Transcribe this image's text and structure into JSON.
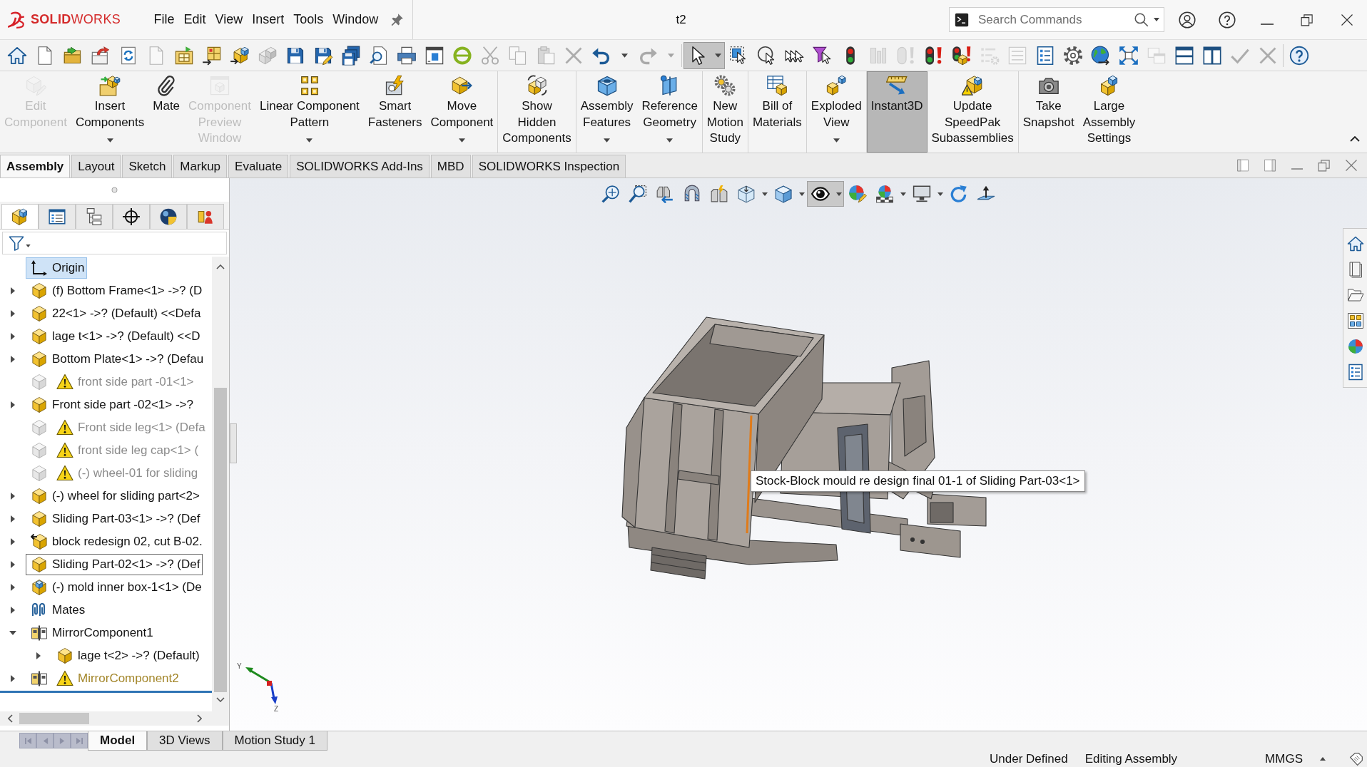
{
  "title_bar": {
    "logo": "**SOLID**WORKS",
    "menu": [
      "File",
      "Edit",
      "View",
      "Insert",
      "Tools",
      "Window"
    ],
    "document_title": "t2",
    "search": {
      "placeholder": "Search Commands"
    }
  },
  "standard_toolbar": {
    "groups": [
      [
        {
          "kind": "button",
          "disabled": false,
          "selected": false
        },
        {
          "kind": "button",
          "disabled": false,
          "selected": false
        },
        {
          "kind": "button",
          "disabled": false,
          "selected": false
        },
        {
          "kind": "button",
          "disabled": false,
          "selected": false
        },
        {
          "kind": "button",
          "disabled": false,
          "selected": false
        },
        {
          "kind": "button",
          "disabled": true,
          "selected": false
        },
        {
          "kind": "button",
          "disabled": false,
          "selected": false
        },
        {
          "kind": "button",
          "disabled": false,
          "selected": false
        },
        {
          "kind": "button",
          "disabled": false,
          "selected": false
        },
        {
          "kind": "button",
          "disabled": true,
          "selected": false
        },
        {
          "kind": "button",
          "disabled": false,
          "selected": false
        },
        {
          "kind": "button",
          "disabled": false,
          "selected": false
        },
        {
          "kind": "button",
          "disabled": false,
          "selected": false
        },
        {
          "kind": "button",
          "disabled": false,
          "selected": false
        },
        {
          "kind": "button",
          "disabled": false,
          "selected": false
        },
        {
          "kind": "button",
          "disabled": false,
          "selected": false
        },
        {
          "kind": "button",
          "disabled": false,
          "selected": false
        },
        {
          "kind": "button",
          "disabled": true,
          "selected": false
        },
        {
          "kind": "button",
          "disabled": true,
          "selected": false
        },
        {
          "kind": "button",
          "disabled": true,
          "selected": false
        },
        {
          "kind": "button",
          "disabled": true,
          "selected": false
        },
        {
          "kind": "split",
          "disabled": false,
          "selected": false
        },
        {
          "kind": "split",
          "disabled": true,
          "selected": false
        }
      ],
      [
        {
          "kind": "split",
          "disabled": false,
          "selected": true
        },
        {
          "kind": "button",
          "disabled": false,
          "selected": false
        },
        {
          "kind": "button",
          "disabled": false,
          "selected": false
        },
        {
          "kind": "button",
          "disabled": false,
          "selected": false
        },
        {
          "kind": "button",
          "disabled": false,
          "selected": false
        },
        {
          "kind": "button",
          "disabled": false,
          "selected": false
        },
        {
          "kind": "button",
          "disabled": true,
          "selected": false
        },
        {
          "kind": "button",
          "disabled": true,
          "selected": false
        },
        {
          "kind": "button",
          "disabled": false,
          "selected": false
        },
        {
          "kind": "button",
          "disabled": false,
          "selected": false
        },
        {
          "kind": "button",
          "disabled": true,
          "selected": false
        },
        {
          "kind": "button",
          "disabled": true,
          "selected": false
        },
        {
          "kind": "button",
          "disabled": false,
          "selected": false
        },
        {
          "kind": "button",
          "disabled": false,
          "selected": false
        },
        {
          "kind": "button",
          "disabled": false,
          "selected": false
        },
        {
          "kind": "button",
          "disabled": false,
          "selected": false
        },
        {
          "kind": "button",
          "disabled": true,
          "selected": false
        },
        {
          "kind": "button",
          "disabled": false,
          "selected": false
        },
        {
          "kind": "button",
          "disabled": false,
          "selected": false
        },
        {
          "kind": "button",
          "disabled": true,
          "selected": false
        },
        {
          "kind": "button",
          "disabled": true,
          "selected": false
        }
      ],
      [
        {
          "kind": "button",
          "disabled": false,
          "selected": false
        }
      ]
    ]
  },
  "command_manager": {
    "groups": [
      [
        {
          "label": "Edit\nComponent",
          "kind": "button",
          "disabled": true,
          "selected": false
        },
        {
          "label": "Insert\nComponents",
          "kind": "split",
          "disabled": false,
          "selected": false
        },
        {
          "label": "Mate",
          "kind": "button",
          "disabled": false,
          "selected": false
        },
        {
          "label": "Component\nPreview\nWindow",
          "kind": "button",
          "disabled": true,
          "selected": false
        },
        {
          "label": "Linear Component\nPattern",
          "kind": "split",
          "disabled": false,
          "selected": false
        },
        {
          "label": "Smart\nFasteners",
          "kind": "button",
          "disabled": false,
          "selected": false
        },
        {
          "label": "Move\nComponent",
          "kind": "split",
          "disabled": false,
          "selected": false
        }
      ],
      [
        {
          "label": "Show\nHidden\nComponents",
          "kind": "button",
          "disabled": false,
          "selected": false
        }
      ],
      [
        {
          "label": "Assembly\nFeatures",
          "kind": "split",
          "disabled": false,
          "selected": false
        },
        {
          "label": "Reference\nGeometry",
          "kind": "split",
          "disabled": false,
          "selected": false
        }
      ],
      [
        {
          "label": "New\nMotion\nStudy",
          "kind": "button",
          "disabled": false,
          "selected": false
        }
      ],
      [
        {
          "label": "Bill of\nMaterials",
          "kind": "button",
          "disabled": false,
          "selected": false
        }
      ],
      [
        {
          "label": "Exploded\nView",
          "kind": "split",
          "disabled": false,
          "selected": false
        }
      ],
      [
        {
          "label": "Instant3D",
          "kind": "button",
          "disabled": false,
          "selected": true
        },
        {
          "label": "Update\nSpeedPak\nSubassemblies",
          "kind": "button",
          "disabled": false,
          "selected": false
        }
      ],
      [
        {
          "label": "Take\nSnapshot",
          "kind": "button",
          "disabled": false,
          "selected": false
        },
        {
          "label": "Large\nAssembly\nSettings",
          "kind": "button",
          "disabled": false,
          "selected": false
        }
      ]
    ]
  },
  "command_tabs": [
    {
      "label": "Assembly",
      "selected": true
    },
    {
      "label": "Layout",
      "selected": false
    },
    {
      "label": "Sketch",
      "selected": false
    },
    {
      "label": "Markup",
      "selected": false
    },
    {
      "label": "Evaluate",
      "selected": false
    },
    {
      "label": "SOLIDWORKS Add-Ins",
      "selected": false
    },
    {
      "label": "MBD",
      "selected": false
    },
    {
      "label": "SOLIDWORKS Inspection",
      "selected": false
    }
  ],
  "feature_tree": {
    "panel_tabs": [
      {
        "selected": true
      },
      {
        "selected": false
      },
      {
        "selected": false
      },
      {
        "selected": false
      },
      {
        "selected": false
      },
      {
        "selected": false
      }
    ],
    "items": [
      {
        "label": "Origin",
        "kind": "origin",
        "expandable": false,
        "expanded": false,
        "suppressed": false,
        "warning": false,
        "selected": true,
        "focused": false
      },
      {
        "label": "(f) Bottom Frame<1> ->? (D",
        "kind": "part",
        "expandable": true,
        "expanded": false,
        "suppressed": false,
        "warning": false,
        "selected": false,
        "focused": false
      },
      {
        "label": "22<1> ->? (Default) <<Defa",
        "kind": "part",
        "expandable": true,
        "expanded": false,
        "suppressed": false,
        "warning": false,
        "selected": false,
        "focused": false
      },
      {
        "label": "lage t<1> ->? (Default) <<D",
        "kind": "part",
        "expandable": true,
        "expanded": false,
        "suppressed": false,
        "warning": false,
        "selected": false,
        "focused": false
      },
      {
        "label": "Bottom Plate<1> ->? (Defau",
        "kind": "part",
        "expandable": true,
        "expanded": false,
        "suppressed": false,
        "warning": false,
        "selected": false,
        "focused": false
      },
      {
        "label": "front side part -01<1>",
        "kind": "part",
        "expandable": false,
        "expanded": false,
        "suppressed": true,
        "warning": true,
        "selected": false,
        "focused": false
      },
      {
        "label": "Front side part -02<1> ->?",
        "kind": "part",
        "expandable": true,
        "expanded": false,
        "suppressed": false,
        "warning": false,
        "selected": false,
        "focused": false
      },
      {
        "label": "Front side leg<1> (Defa",
        "kind": "part",
        "expandable": false,
        "expanded": false,
        "suppressed": true,
        "warning": true,
        "selected": false,
        "focused": false
      },
      {
        "label": "front side leg cap<1> (",
        "kind": "part",
        "expandable": false,
        "expanded": false,
        "suppressed": true,
        "warning": true,
        "selected": false,
        "focused": false
      },
      {
        "label": "(-) wheel-01 for sliding",
        "kind": "part",
        "expandable": false,
        "expanded": false,
        "suppressed": true,
        "warning": true,
        "selected": false,
        "focused": false
      },
      {
        "label": "(-) wheel for sliding part<2>",
        "kind": "part",
        "expandable": true,
        "expanded": false,
        "suppressed": false,
        "warning": false,
        "selected": false,
        "focused": false
      },
      {
        "label": "Sliding Part-03<1> ->? (Def",
        "kind": "part",
        "expandable": true,
        "expanded": false,
        "suppressed": false,
        "warning": false,
        "selected": false,
        "focused": false
      },
      {
        "label": "block redesign 02, cut B-02.",
        "kind": "derived",
        "expandable": true,
        "expanded": false,
        "suppressed": false,
        "warning": false,
        "selected": false,
        "focused": false
      },
      {
        "label": "Sliding Part-02<1> ->? (Def",
        "kind": "part",
        "expandable": true,
        "expanded": false,
        "suppressed": false,
        "warning": false,
        "selected": false,
        "focused": true
      },
      {
        "label": "(-) mold inner box-1<1> (De",
        "kind": "assembly",
        "expandable": true,
        "expanded": false,
        "suppressed": false,
        "warning": false,
        "selected": false,
        "focused": false
      },
      {
        "label": "Mates",
        "kind": "mates",
        "expandable": true,
        "expanded": false,
        "suppressed": false,
        "warning": false,
        "selected": false,
        "focused": false
      },
      {
        "label": "MirrorComponent1",
        "kind": "mirror",
        "expandable": true,
        "expanded": true,
        "suppressed": false,
        "warning": false,
        "selected": false,
        "focused": false,
        "children": [
          {
            "label": "lage t<2> ->? (Default)",
            "kind": "part",
            "expandable": true,
            "expanded": false,
            "suppressed": false,
            "warning": false,
            "selected": false,
            "focused": false
          }
        ]
      },
      {
        "label": "MirrorComponent2",
        "kind": "mirror",
        "expandable": true,
        "expanded": false,
        "suppressed": false,
        "warning": true,
        "selected": false,
        "focused": false
      }
    ]
  },
  "heads_up_toolbar": {
    "items": [
      {
        "kind": "button",
        "selected": false
      },
      {
        "kind": "button",
        "selected": false
      },
      {
        "kind": "button",
        "selected": false
      },
      {
        "kind": "button",
        "selected": false
      },
      {
        "kind": "button",
        "selected": false
      },
      {
        "kind": "split",
        "selected": false
      },
      {
        "kind": "split",
        "selected": false
      },
      {
        "kind": "split",
        "selected": true
      },
      {
        "kind": "button",
        "selected": false
      },
      {
        "kind": "split",
        "selected": false
      },
      {
        "kind": "split",
        "selected": false
      },
      {
        "kind": "button",
        "selected": false
      },
      {
        "kind": "button",
        "selected": false
      }
    ]
  },
  "tooltip": {
    "text": "Stock-Block mould re design final 01-1 of Sliding Part-03<1>"
  },
  "triad": {
    "labels": [
      "Y",
      "Z"
    ]
  },
  "bottom_tabs": [
    {
      "label": "Model",
      "selected": true
    },
    {
      "label": "3D Views",
      "selected": false
    },
    {
      "label": "Motion Study 1",
      "selected": false
    }
  ],
  "status_bar": {
    "items": [
      "Under Defined",
      "Editing Assembly",
      "MMGS"
    ]
  }
}
